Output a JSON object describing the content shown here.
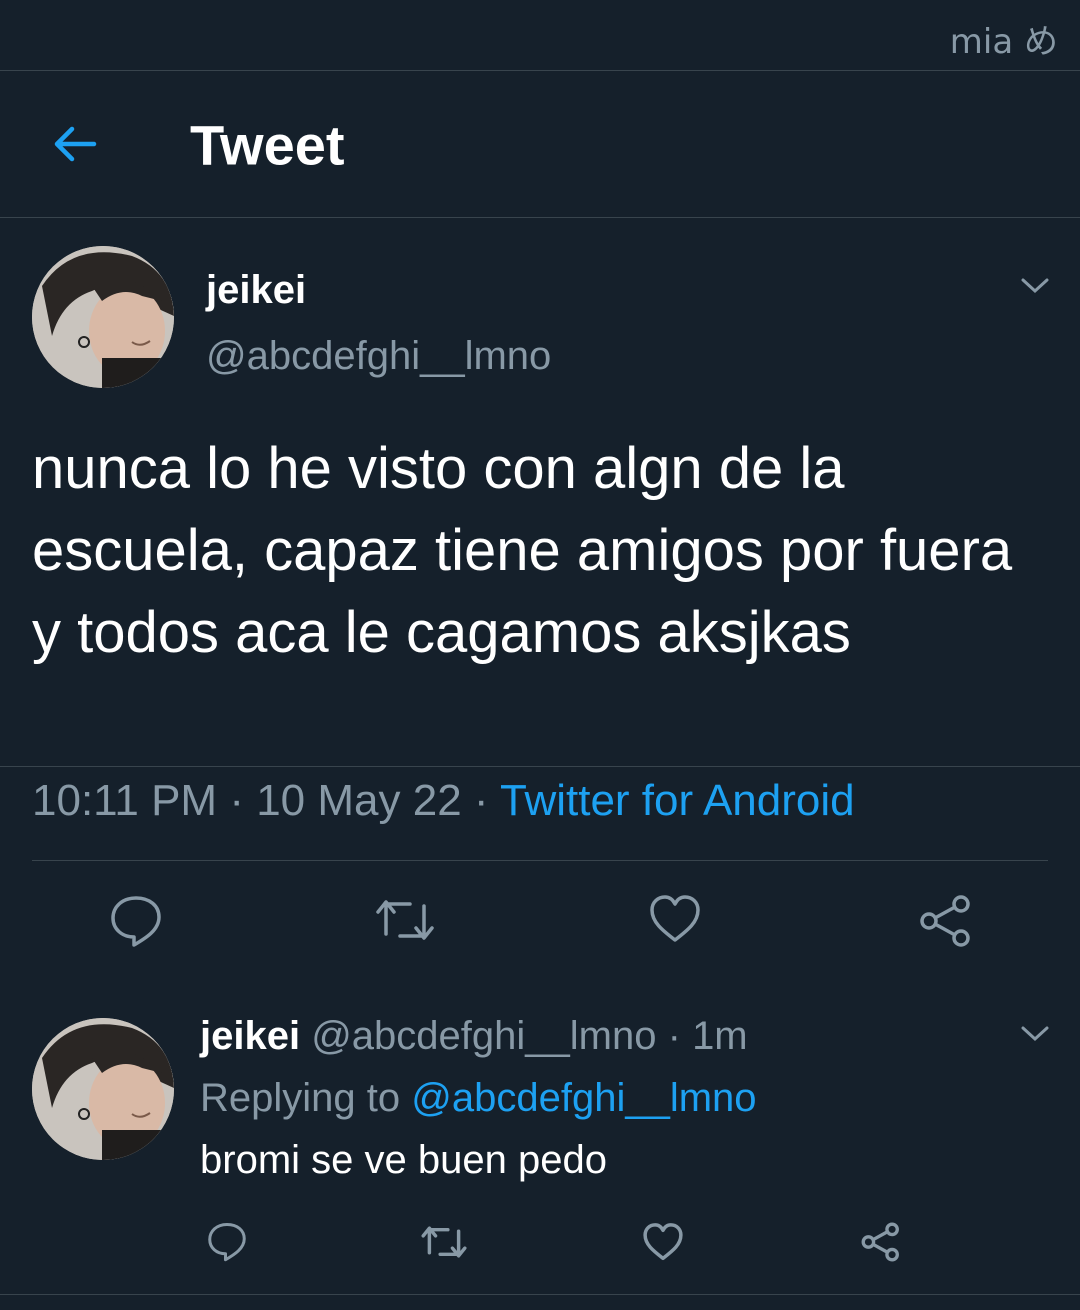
{
  "status_bar": {
    "watermark": "mia め"
  },
  "header": {
    "back_icon": "arrow-left-icon",
    "title": "Tweet"
  },
  "tweet": {
    "author_name": "jeikei",
    "author_handle": "@abcdefghi__lmno",
    "text": "nunca lo he visto con algn de la escuela, capaz tiene amigos por fuera y todos aca le cagamos aksjkas",
    "time": "10:11 PM",
    "date": "10 May 22",
    "source": "Twitter for Android",
    "separator": "·",
    "actions": [
      "reply-icon",
      "retweet-icon",
      "like-icon",
      "share-icon"
    ]
  },
  "reply": {
    "author_name": "jeikei",
    "author_handle": "@abcdefghi__lmno",
    "age": "1m",
    "replying_to_label": "Replying to",
    "replying_to_handle": "@abcdefghi__lmno",
    "text": "bromi se ve buen pedo"
  },
  "colors": {
    "background": "#15202b",
    "accent": "#1da1f2",
    "secondary_text": "#8899a6",
    "divider": "#38444d"
  }
}
